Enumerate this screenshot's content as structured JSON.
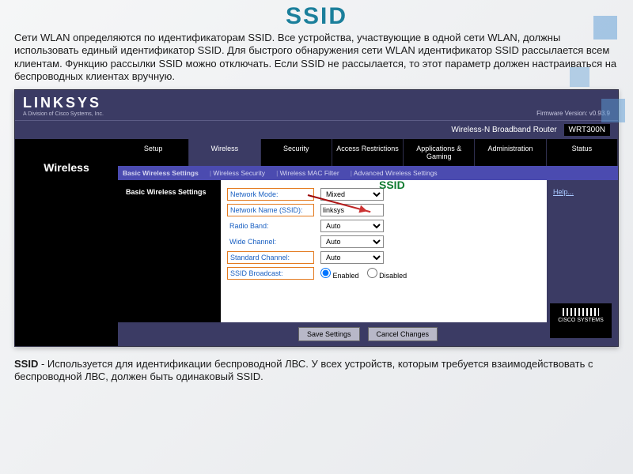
{
  "title": "SSID",
  "intro": "Сети WLAN определяются по идентификаторам SSID. Все устройства, участвующие в одной сети WLAN, должны использовать единый идентификатор SSID. Для быстрого обнаружения сети WLAN идентификатор SSID рассылается всем клиентам. Функцию рассылки SSID можно отключать. Если SSID не рассылается, то этот параметр должен настраиваться на беспроводных клиентах вручную.",
  "ssid_callout": "SSID",
  "footer_bold": "SSID",
  "footer_rest": " - Используется для идентификации беспроводной ЛВС. У всех устройств, которым требуется взаимодействовать с беспроводной ЛВС, должен быть одинаковый SSID.",
  "router": {
    "logo": "LINKSYS",
    "logo_sub": "A Division of Cisco Systems, Inc.",
    "firmware": "Firmware Version: v0.93.9",
    "product": "Wireless-N Broadband Router",
    "model": "WRT300N",
    "left_title": "Wireless",
    "tabs": [
      "Setup",
      "Wireless",
      "Security",
      "Access Restrictions",
      "Applications & Gaming",
      "Administration",
      "Status"
    ],
    "subtabs": [
      "Basic Wireless Settings",
      "Wireless Security",
      "Wireless MAC Filter",
      "Advanced Wireless Settings"
    ],
    "side_title": "Basic Wireless Settings",
    "help": "Help...",
    "fields": {
      "mode_label": "Network Mode:",
      "mode_value": "Mixed",
      "ssid_label": "Network Name (SSID):",
      "ssid_value": "linksys",
      "band_label": "Radio Band:",
      "band_value": "Auto",
      "wide_label": "Wide Channel:",
      "wide_value": "Auto",
      "std_label": "Standard Channel:",
      "std_value": "Auto",
      "broadcast_label": "SSID Broadcast:",
      "broadcast_enabled": "Enabled",
      "broadcast_disabled": "Disabled"
    },
    "buttons": {
      "save": "Save Settings",
      "cancel": "Cancel Changes"
    },
    "cisco": "CISCO SYSTEMS"
  }
}
